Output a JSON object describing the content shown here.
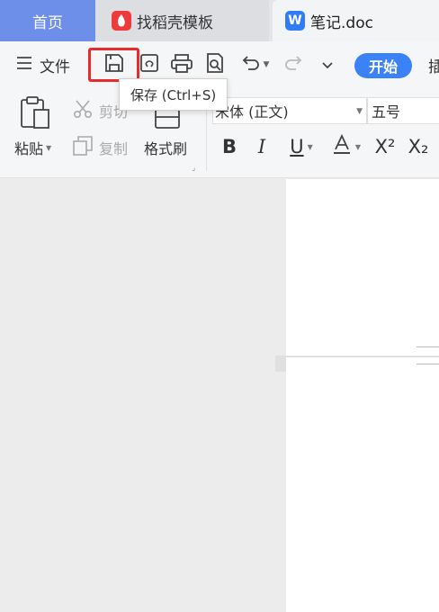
{
  "tabs": {
    "home": "首页",
    "templates": "找稻壳模板",
    "templates_logo": "W-red-logo",
    "document": "笔记.doc",
    "document_logo": "W"
  },
  "toolbar": {
    "menu_label": "文件",
    "start_label": "开始",
    "cut_off_label": "插",
    "save_tooltip": "保存 (Ctrl+S)",
    "highlight_color": "#e52d2d",
    "accent_color": "#3b82f6"
  },
  "ribbon": {
    "paste_label": "粘贴",
    "cut_label": "剪切",
    "copy_label": "复制",
    "format_painter_label": "格式刷",
    "font_name": "宋体 (正文)",
    "font_size": "五号",
    "superscript": "X²",
    "subscript": "X₂"
  }
}
